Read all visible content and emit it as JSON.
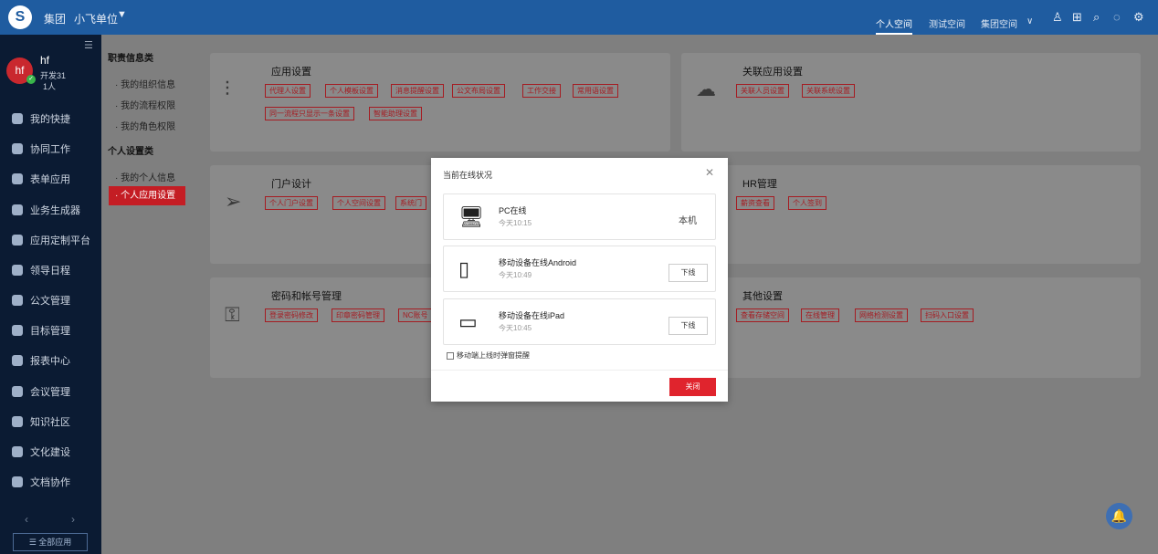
{
  "topbar": {
    "logo_glyph": "S",
    "org": "集团",
    "unit": "小飞单位",
    "unit_caret": "▼",
    "spaces": [
      "个人空间",
      "测试空间",
      "集团空间"
    ],
    "spaces_caret": "∨",
    "icons": [
      "user-icon",
      "apps-icon",
      "search-icon",
      "chat-icon",
      "settings-icon"
    ],
    "icon_glyphs": [
      "♙",
      "⊞",
      "⌕",
      "◌",
      "⚙"
    ]
  },
  "sidebar": {
    "collapse_glyph": "☰",
    "user": {
      "avatar": "hf",
      "badge": "✓",
      "name": "hf",
      "dept": "开发31",
      "count": "1人"
    },
    "items": [
      "我的快捷",
      "协同工作",
      "表单应用",
      "业务生成器",
      "应用定制平台",
      "领导日程",
      "公文管理",
      "目标管理",
      "报表中心",
      "会议管理",
      "知识社区",
      "文化建设",
      "文档协作"
    ],
    "prev": "‹",
    "next": "›",
    "all_apps": "☰ 全部应用"
  },
  "submenu": {
    "group1": "职责信息类",
    "group1_items": [
      "· 我的组织信息",
      "· 我的流程权限",
      "· 我的角色权限"
    ],
    "group2": "个人设置类",
    "group2_items": [
      "· 我的个人信息",
      "· 个人应用设置"
    ]
  },
  "cards": {
    "app_settings": {
      "title": "应用设置",
      "tags": [
        "代理人设置",
        "个人模板设置",
        "消息提醒设置",
        "公文布局设置",
        "工作交接",
        "常用语设置",
        "同一流程只显示一条设置",
        "智能助理设置"
      ]
    },
    "related_settings": {
      "title": "关联应用设置",
      "tags": [
        "关联人员设置",
        "关联系统设置"
      ]
    },
    "portal_design": {
      "title": "门户设计",
      "tags": [
        "个人门户设置",
        "个人空间设置",
        "系统门"
      ]
    },
    "hr": {
      "title": "HR管理",
      "tags": [
        "薪资查看",
        "个人签到"
      ]
    },
    "password": {
      "title": "密码和帐号管理",
      "tags": [
        "登录密码修改",
        "印章密码管理",
        "NC账号"
      ]
    },
    "other": {
      "title": "其他设置",
      "tags": [
        "查看存储空间",
        "在线管理",
        "网络检测设置",
        "扫码入口设置"
      ]
    }
  },
  "modal": {
    "title": "当前在线状况",
    "close_glyph": "✕",
    "devices": [
      {
        "icon": "monitor-icon",
        "glyph": "🖥",
        "name": "PC在线",
        "time": "今天10:15",
        "status": "本机"
      },
      {
        "icon": "phone-icon",
        "glyph": "▯",
        "name": "移动设备在线Android",
        "time": "今天10:49",
        "action": "下线"
      },
      {
        "icon": "tablet-icon",
        "glyph": "▭",
        "name": "移动设备在线iPad",
        "time": "今天10:45",
        "action": "下线"
      }
    ],
    "checkbox_label": "移动端上线时弹窗提醒",
    "ok": "关闭"
  },
  "bell_glyph": "🔔"
}
